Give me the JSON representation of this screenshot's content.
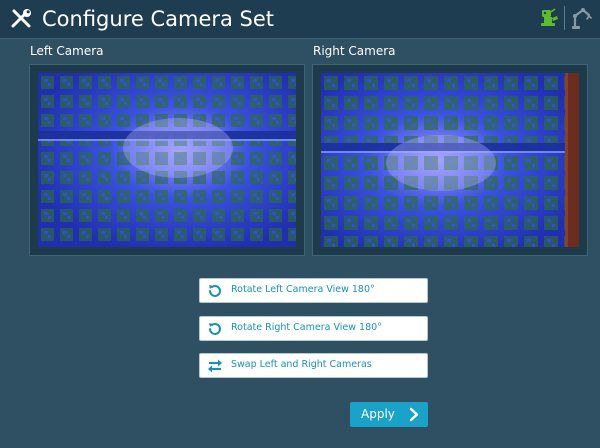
{
  "header": {
    "title": "Configure Camera Set",
    "left_icon": "tools-icon",
    "right_icons": [
      "robot-status-icon",
      "robot-arm-icon"
    ]
  },
  "cameras": {
    "left": {
      "label": "Left Camera"
    },
    "right": {
      "label": "Right Camera"
    }
  },
  "actions": [
    {
      "label": "Rotate Left Camera View 180°",
      "icon": "rotate-icon"
    },
    {
      "label": "Rotate Right Camera View 180°",
      "icon": "rotate-icon"
    },
    {
      "label": "Swap Left and Right Cameras",
      "icon": "swap-icon"
    }
  ],
  "apply": {
    "label": "Apply",
    "icon": "chevron-right-icon"
  },
  "colors": {
    "header_bg": "#1f3d50",
    "page_bg": "#2f4f62",
    "accent": "#1aa2c9",
    "button_text": "#1791b8",
    "robot_green": "#5dbb2f"
  }
}
